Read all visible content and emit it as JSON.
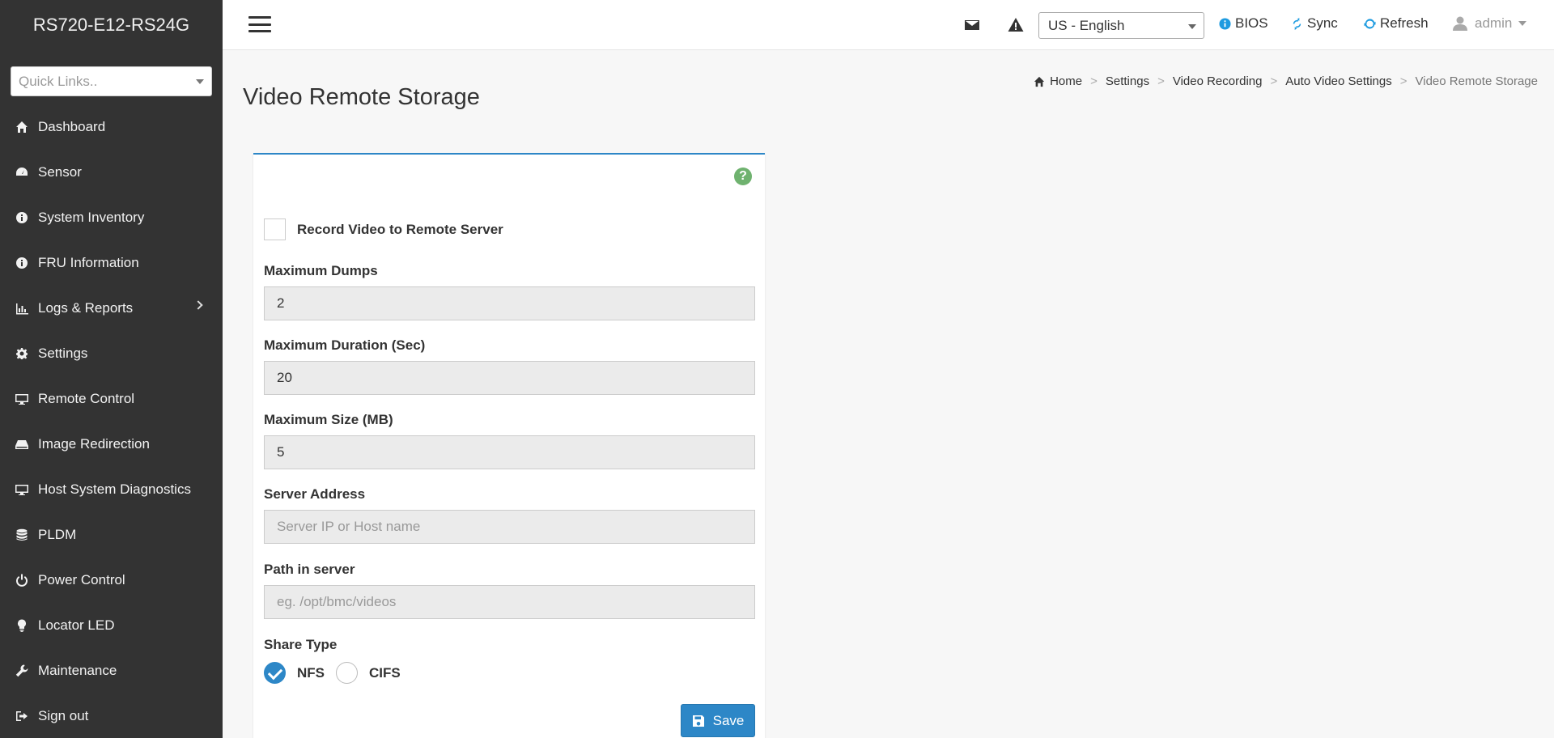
{
  "sidebar": {
    "brand": "RS720-E12-RS24G",
    "quick_links_placeholder": "Quick Links..",
    "items": [
      {
        "label": "Dashboard",
        "icon": "home-icon"
      },
      {
        "label": "Sensor",
        "icon": "dashboard-gauge-icon"
      },
      {
        "label": "System Inventory",
        "icon": "info-circle-icon"
      },
      {
        "label": "FRU Information",
        "icon": "info-circle-icon"
      },
      {
        "label": "Logs & Reports",
        "icon": "bar-chart-icon"
      },
      {
        "label": "Settings",
        "icon": "gear-icon"
      },
      {
        "label": "Remote Control",
        "icon": "desktop-icon"
      },
      {
        "label": "Image Redirection",
        "icon": "hdd-icon"
      },
      {
        "label": "Host System Diagnostics",
        "icon": "desktop-icon"
      },
      {
        "label": "PLDM",
        "icon": "database-icon"
      },
      {
        "label": "Power Control",
        "icon": "power-icon"
      },
      {
        "label": "Locator LED",
        "icon": "lightbulb-icon"
      },
      {
        "label": "Maintenance",
        "icon": "wrench-icon"
      },
      {
        "label": "Sign out",
        "icon": "sign-out-icon"
      }
    ]
  },
  "header": {
    "language": "US - English",
    "bios": "BIOS",
    "sync": "Sync",
    "refresh": "Refresh",
    "user": "admin"
  },
  "page": {
    "title": "Video Remote Storage",
    "breadcrumb": [
      "Home",
      "Settings",
      "Video Recording",
      "Auto Video Settings",
      "Video Remote Storage"
    ]
  },
  "form": {
    "record_label": "Record Video to Remote Server",
    "max_dumps_label": "Maximum Dumps",
    "max_dumps_value": "2",
    "max_duration_label": "Maximum Duration (Sec)",
    "max_duration_value": "20",
    "max_size_label": "Maximum Size (MB)",
    "max_size_value": "5",
    "server_label": "Server Address",
    "server_placeholder": "Server IP or Host name",
    "path_label": "Path in server",
    "path_placeholder": "eg. /opt/bmc/videos",
    "share_type_label": "Share Type",
    "share_nfs": "NFS",
    "share_cifs": "CIFS",
    "save_label": "Save"
  },
  "colors": {
    "accent": "#2d87c7",
    "sidebar_bg": "#333333",
    "help": "#6fb26f"
  }
}
